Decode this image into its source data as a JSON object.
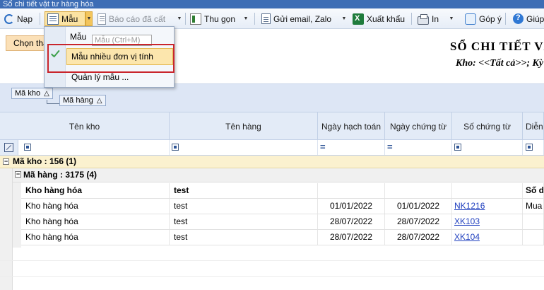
{
  "window": {
    "title": "Sổ chi tiết vật tư hàng hóa"
  },
  "toolbar": {
    "refresh_label": "Nạp",
    "template_label": "Mẫu",
    "saved_reports_label": "Báo cáo đã cất",
    "collapse_label": "Thu gọn",
    "email_label": "Gửi email, Zalo",
    "export_label": "Xuất khẩu",
    "print_label": "In",
    "feedback_label": "Góp ý",
    "help_label": "Giúp"
  },
  "template_menu": {
    "items": [
      {
        "label": "Mẫu"
      },
      {
        "label": "Mẫu nhiều đơn vị tính",
        "checked": true
      },
      {
        "label": "Quản lý mẫu ..."
      }
    ],
    "tooltip": "Mẫu (Ctrl+M)"
  },
  "header": {
    "choose_button": "Chọn tham số",
    "report_title": "SỔ CHI TIẾT VẬT TƯ HÀNG HÓA",
    "report_subtitle": "Kho: <<Tất cả>>; Kỳ"
  },
  "group_panel": {
    "chips": [
      {
        "label": "Mã kho"
      },
      {
        "label": "Mã hàng"
      }
    ]
  },
  "grid": {
    "columns": [
      "Tên kho",
      "Tên hàng",
      "Ngày hạch toán",
      "Ngày chứng từ",
      "Số chứng từ",
      "Diễn giải"
    ],
    "group_level1": "Mã kho : 156 (1)",
    "group_level2": "Mã hàng : 3175 (4)",
    "summary_row": {
      "ten_kho": "Kho hàng hóa",
      "ten_hang": "test",
      "extra": "Số dư đầu kỳ"
    },
    "rows": [
      {
        "ten_kho": "Kho hàng hóa",
        "ten_hang": "test",
        "ngay_hach_toan": "01/01/2022",
        "ngay_chung_tu": "01/01/2022",
        "so_chung_tu": "NK1216",
        "dien_giai": "Mua hàng"
      },
      {
        "ten_kho": "Kho hàng hóa",
        "ten_hang": "test",
        "ngay_hach_toan": "28/07/2022",
        "ngay_chung_tu": "28/07/2022",
        "so_chung_tu": "XK103",
        "dien_giai": ""
      },
      {
        "ten_kho": "Kho hàng hóa",
        "ten_hang": "test",
        "ngay_hach_toan": "28/07/2022",
        "ngay_chung_tu": "28/07/2022",
        "so_chung_tu": "XK104",
        "dien_giai": ""
      }
    ]
  }
}
